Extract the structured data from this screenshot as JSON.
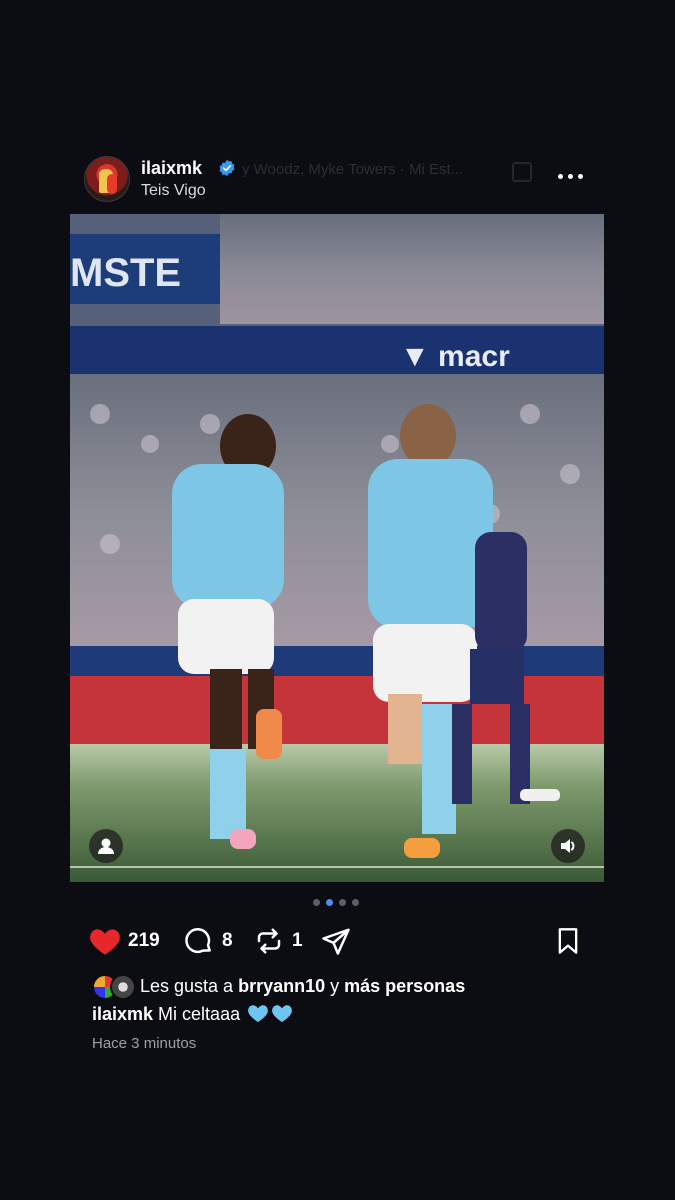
{
  "post": {
    "author": {
      "username": "ilaixmk",
      "verified": true,
      "avatar_icon": "avatar-image",
      "location": "Teis Vigo"
    },
    "music": {
      "text": "y Woodz, Myke Towers · Mi Est...",
      "icon": "music-icon"
    },
    "more_icon": "more-dots-icon",
    "media": {
      "carousel_count": 4,
      "active_index": 1,
      "user_tag_icon": "person-icon",
      "sound_icon": "speaker-icon"
    },
    "actions": {
      "likes": "219",
      "comments": "8",
      "reposts": "1",
      "like_color": "#e8272d"
    },
    "liked_by": {
      "prefix": "Les gusta a ",
      "user": "brryann10",
      "connector": " y ",
      "others": "más personas"
    },
    "caption": {
      "username": "ilaixmk",
      "text": " Mi celtaaa",
      "emojis": [
        "blue-heart-icon",
        "blue-heart-icon"
      ]
    },
    "timestamp": "Hace 3 minutos"
  }
}
